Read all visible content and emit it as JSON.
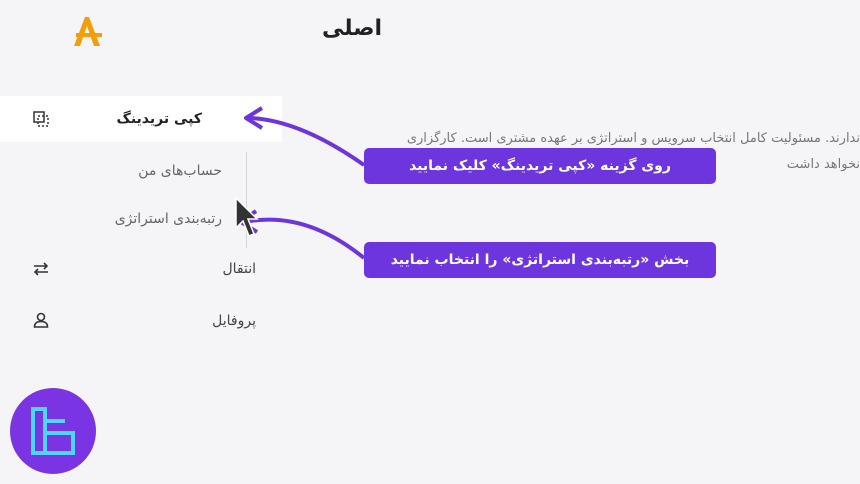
{
  "header": {
    "title": "اصلی"
  },
  "sidebar": {
    "items": [
      {
        "label": "کپی تریدینگ",
        "icon": "copy-trading-icon",
        "active": true
      },
      {
        "label": "حساب‌های من",
        "icon": "",
        "sub": true
      },
      {
        "label": "رتبه‌بندی استراتژی",
        "icon": "",
        "sub": true
      },
      {
        "label": "انتقال",
        "icon": "transfer-arrows-icon"
      },
      {
        "label": "پروفایل",
        "icon": "user-icon"
      }
    ]
  },
  "main": {
    "text_line1": "ندارند. مسئولیت کامل انتخاب سرویس و استراتژی بر عهده مشتری است. کارگزاری",
    "text_line2": "نخواهد داشت"
  },
  "callouts": {
    "first": "روی گزینه «کپی تریدینگ» کلیک نمایید",
    "second": "بخش «رتبه‌بندی استراتژی» را انتخاب نمایید"
  },
  "colors": {
    "accent": "#6c35de",
    "logo": "#f59e0b",
    "watermark": "#7b34e4"
  }
}
